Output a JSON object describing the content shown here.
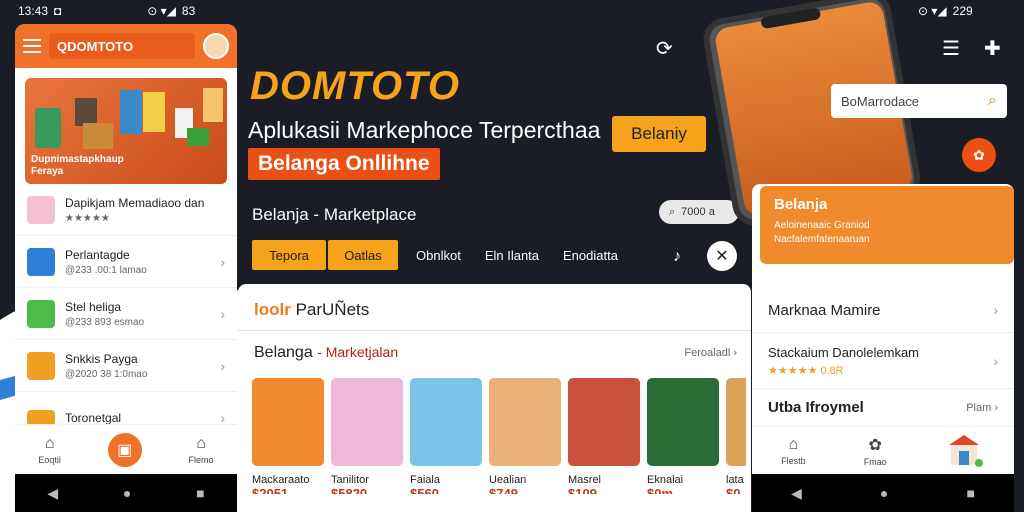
{
  "status_left": {
    "time": "13:43",
    "battery": "83"
  },
  "status_right": {
    "battery": "229"
  },
  "left_app": {
    "search_text": "QDOMTOTO",
    "banner_text": "Dupnimastapkhaup Feraya",
    "rows": [
      {
        "title": "Dapikjam Memadiaoo dan",
        "sub": "★★★★★",
        "icon_color": "#f5c0cf"
      },
      {
        "title": "Perlantagde",
        "sub": "@233 .00:1 lamao",
        "icon_color": "#2f7fd8"
      },
      {
        "title": "Stel heliga",
        "sub": "@233 893 esmao",
        "icon_color": "#4cbb4a"
      },
      {
        "title": "Snkkis Payga",
        "sub": "@2020 38 1:0mao",
        "icon_color": "#f0a020"
      },
      {
        "title": "Toronetgal",
        "sub": "",
        "icon_color": "#f0a020"
      }
    ],
    "nav": {
      "home": "Eoqtil",
      "cart": "",
      "profile": "Flemo"
    }
  },
  "hero": {
    "brand": "DOMTOTO",
    "tagline": "Aplukasii Markephoce Terpercthaa",
    "online_button": "Belanga Onllihne",
    "belanja_button": "Belaniy",
    "subtitle": "Belanja - Marketplace",
    "search_pill": "7000 a",
    "tabs": [
      "Tepora",
      "Oatlas",
      "Obnlkot",
      "Eln Ilanta",
      "Enodiatta"
    ]
  },
  "catalog": {
    "header_orange": "loolr",
    "header_rest": "ParUÑets",
    "section_title": "Belanga",
    "section_sub": "Marketjalan",
    "see_all": "Feroaladl",
    "products": [
      {
        "name": "Mackaraato",
        "price": "$2051",
        "color": "#f08a2c"
      },
      {
        "name": "Tanilitor",
        "price": "$5820",
        "color": "#f0b7d6"
      },
      {
        "name": "Faiala",
        "price": "$560",
        "color": "#7ac4e8"
      },
      {
        "name": "Uealian",
        "price": "$749",
        "color": "#e9b07a"
      },
      {
        "name": "Masrel",
        "price": "$109",
        "color": "#c9503a"
      },
      {
        "name": "Eknalai",
        "price": "$0m",
        "color": "#2b6b35"
      },
      {
        "name": "lata",
        "price": "$0",
        "color": "#d9a15a"
      }
    ]
  },
  "right_app": {
    "search_text": "BoMarrodace",
    "banner_title": "Belanja",
    "banner_sub1": "Aeloinenaaic Graniod",
    "banner_sub2": "Nacfalemfatenaaruan",
    "row1": "Marknaa Mamire",
    "row2": "Stackaium Danolelemkam",
    "row2_sub": "★★★★★ 0.8R",
    "row3": "Utba Ifroymel",
    "row3_right": "Plam",
    "nav": {
      "home": "Flestb",
      "cat": "Fmao"
    }
  }
}
